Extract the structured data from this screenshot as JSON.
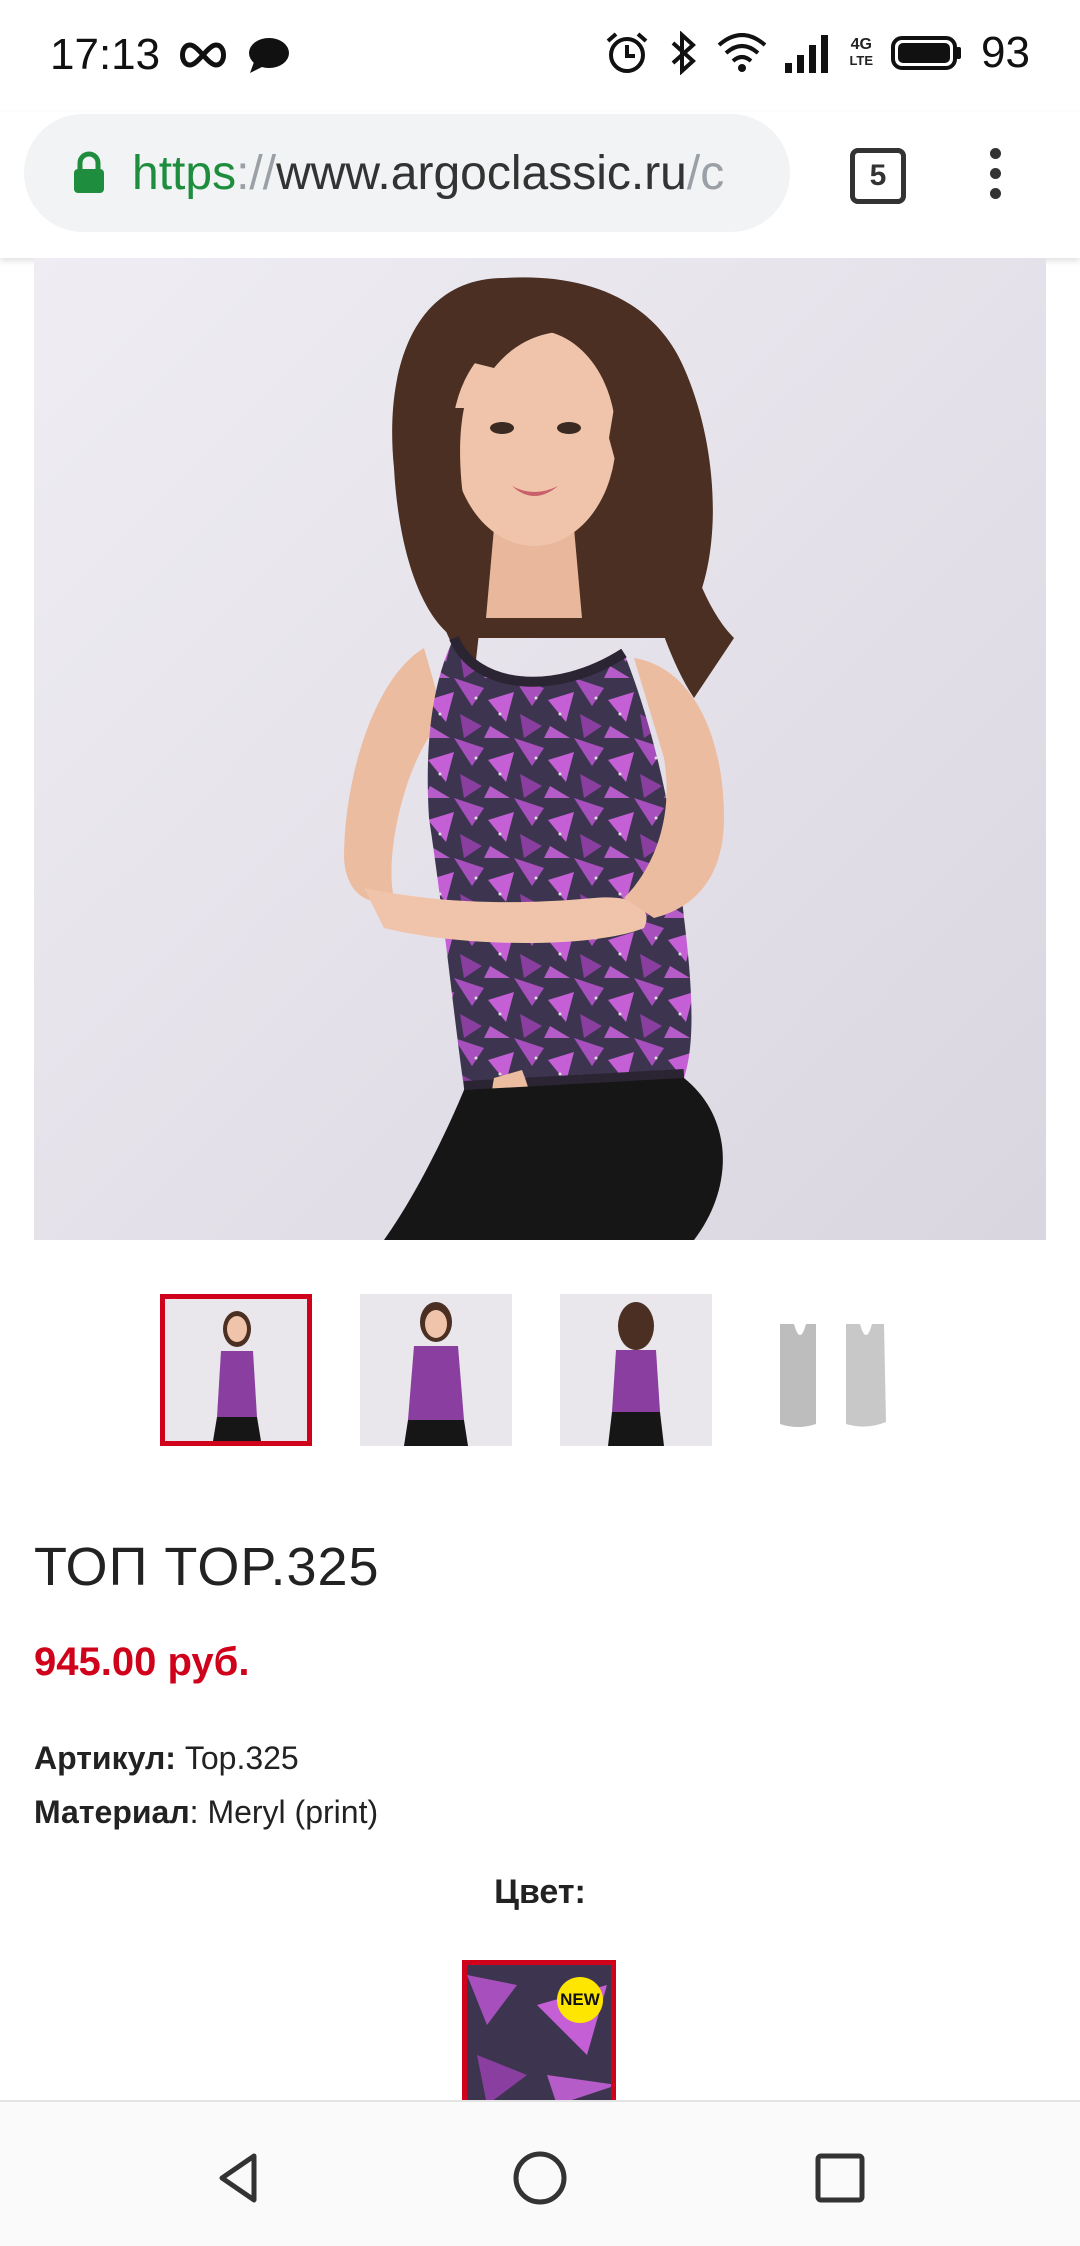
{
  "status_bar": {
    "time": "17:13",
    "battery": "93",
    "icons": [
      "infinity-icon",
      "chat-icon",
      "alarm-icon",
      "bluetooth-icon",
      "wifi-icon",
      "signal-icon",
      "4g-lte-icon",
      "battery-icon"
    ],
    "network_label_top": "4G",
    "network_label_bottom": "LTE"
  },
  "browser": {
    "url_scheme": "https",
    "url_sep": "://",
    "url_host": "www.argoclassic.ru",
    "url_rest": "/c",
    "tab_count": "5"
  },
  "product": {
    "title": "ТОП TOP.325",
    "price": "945.00 руб.",
    "article_label": "Артикул:",
    "article_value": " Top.325",
    "material_label": "Материал",
    "material_value": ": Meryl (print)",
    "color_label": "Цвет:",
    "new_badge": "NEW"
  },
  "colors": {
    "accent": "#d0021b",
    "url_green": "#1e8e3e",
    "print_purple": "#a64fbd",
    "print_dark": "#3d3550"
  }
}
